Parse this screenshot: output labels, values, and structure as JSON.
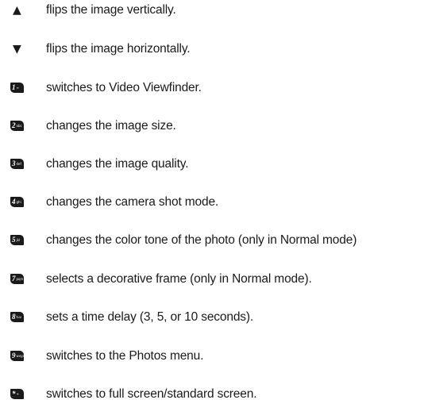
{
  "items": [
    {
      "icon": "up-triangle-icon",
      "glyph": "▲",
      "text": "flips the image vertically."
    },
    {
      "icon": "down-triangle-icon",
      "glyph": "▼",
      "text": "flips the image horizontally."
    },
    {
      "icon": "key-1-icon",
      "key": "1",
      "key_sub": "∞",
      "text": "switches to Video Viewfinder."
    },
    {
      "icon": "key-2-icon",
      "key": "2",
      "key_sub": "abc",
      "text": "changes the image size."
    },
    {
      "icon": "key-3-icon",
      "key": "3",
      "key_sub": "def",
      "text": "changes the image quality."
    },
    {
      "icon": "key-4-icon",
      "key": "4",
      "key_sub": "ghi",
      "text": "changes the camera shot mode."
    },
    {
      "icon": "key-5-icon",
      "key": "5",
      "key_sub": "jkl",
      "text": "changes the color tone of the photo (only in Normal mode)"
    },
    {
      "icon": "key-7-icon",
      "key": "7",
      "key_sub": "pqrs",
      "text": "selects a decorative frame (only in Normal mode)."
    },
    {
      "icon": "key-8-icon",
      "key": "8",
      "key_sub": "tuv",
      "text": "sets a time delay (3, 5, or 10 seconds)."
    },
    {
      "icon": "key-9-icon",
      "key": "9",
      "key_sub": "wxyz",
      "text": "switches to the Photos menu."
    },
    {
      "icon": "key-star-icon",
      "key": "*",
      "key_sub": "+",
      "text": "switches to full screen/standard screen."
    }
  ]
}
